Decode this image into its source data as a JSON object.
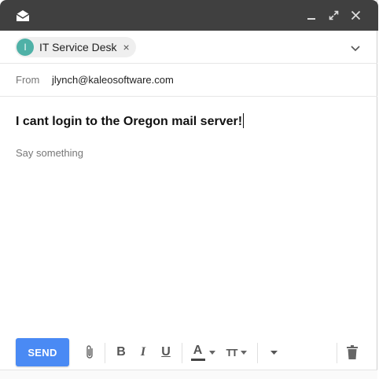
{
  "to": {
    "recipient_initial": "I",
    "recipient_name": "IT Service Desk",
    "remove_symbol": "×"
  },
  "from": {
    "label": "From",
    "address": "jlynch@kaleosoftware.com"
  },
  "subject": "I cant login to the Oregon mail server!",
  "body": {
    "placeholder": "Say something"
  },
  "toolbar": {
    "send_label": "SEND",
    "bold_label": "B",
    "italic_label": "I",
    "underline_label": "U",
    "text_color_label": "A",
    "font_size_label": "TT"
  },
  "colors": {
    "title_bar": "#404040",
    "send_button": "#4a8af4",
    "avatar": "#4fb1a7"
  },
  "icons": [
    "mail-icon",
    "minimize-icon",
    "expand-icon",
    "close-icon",
    "chevron-down-icon",
    "attach-icon",
    "dropdown-icon",
    "trash-icon"
  ]
}
